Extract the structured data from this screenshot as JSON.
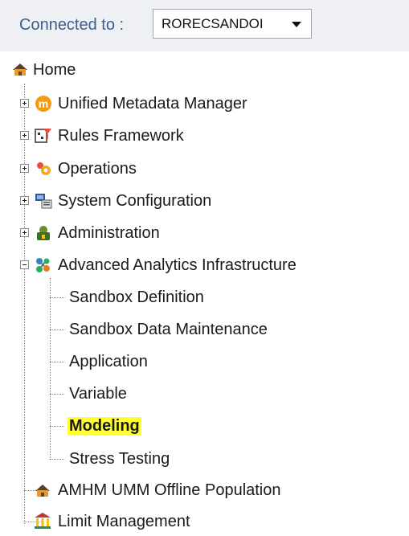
{
  "connection": {
    "label": "Connected to :",
    "value": "RORECSANDOI"
  },
  "tree": {
    "home": "Home",
    "items": [
      {
        "label": "Unified Metadata Manager",
        "icon": "metadata-manager-icon",
        "expanded": false
      },
      {
        "label": "Rules Framework",
        "icon": "rules-framework-icon",
        "expanded": false
      },
      {
        "label": "Operations",
        "icon": "operations-icon",
        "expanded": false
      },
      {
        "label": "System Configuration",
        "icon": "system-configuration-icon",
        "expanded": false
      },
      {
        "label": "Administration",
        "icon": "administration-icon",
        "expanded": false
      },
      {
        "label": "Advanced Analytics Infrastructure",
        "icon": "analytics-icon",
        "expanded": true
      }
    ],
    "children": [
      "Sandbox Definition",
      "Sandbox Data Maintenance",
      "Application",
      "Variable",
      "Modeling",
      "Stress Testing"
    ],
    "selected_child": "Modeling",
    "selected_highlight": "#ffff33",
    "bottom_items": [
      {
        "label": "AMHM UMM Offline Population",
        "icon": "house-icon"
      },
      {
        "label": "Limit Management",
        "icon": "bank-icon"
      }
    ]
  }
}
